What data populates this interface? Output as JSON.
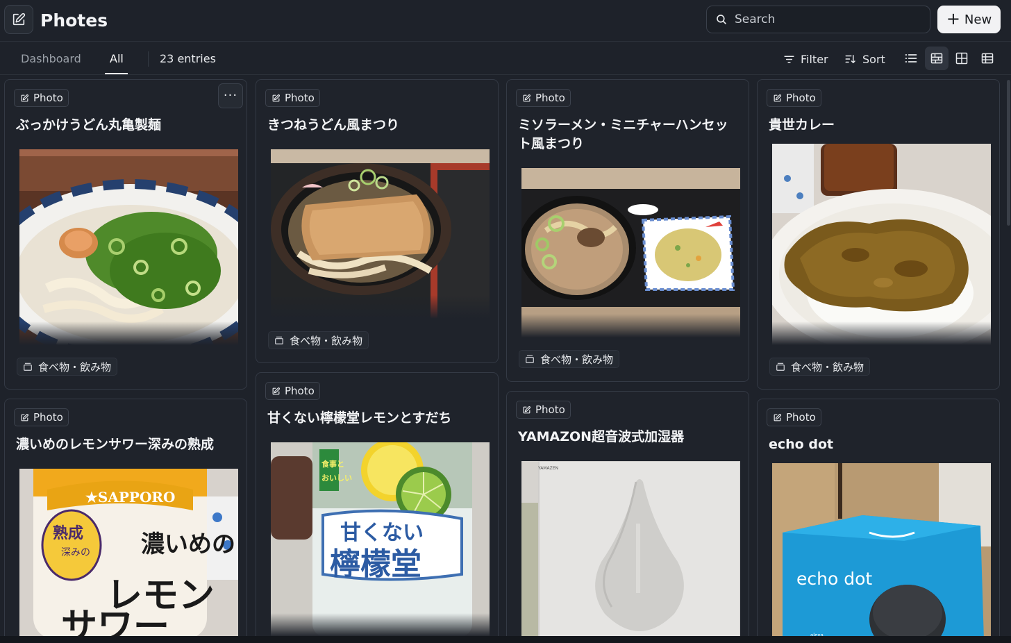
{
  "app": {
    "title": "Photes",
    "icon": "edit-square-icon"
  },
  "search": {
    "placeholder": "Search",
    "icon": "search-icon"
  },
  "new_button": {
    "label": "New",
    "icon": "plus-icon"
  },
  "tabs": [
    {
      "label": "Dashboard",
      "active": false
    },
    {
      "label": "All",
      "active": true
    }
  ],
  "entries_count": "23 entries",
  "toolbar": {
    "filter_label": "Filter",
    "sort_label": "Sort",
    "views": [
      "list-view-icon",
      "masonry-view-icon",
      "grid-view-icon",
      "table-view-icon"
    ],
    "active_view": "masonry-view-icon"
  },
  "cards": [
    {
      "badge": "Photo",
      "title": "ぶっかけうどん丸亀製麺",
      "tag": "食べ物・飲み物",
      "photo": "udon-bowl-with-green-onions"
    },
    {
      "badge": "Photo",
      "title": "きつねうどん風まつり",
      "tag": "食べ物・飲み物",
      "photo": "kitsune-udon-bowl"
    },
    {
      "badge": "Photo",
      "title": "ミソラーメン・ミニチャーハンセット風まつり",
      "tag": "食べ物・飲み物",
      "photo": "miso-ramen-and-fried-rice-tray"
    },
    {
      "badge": "Photo",
      "title": "貴世カレー",
      "tag": "食べ物・飲み物",
      "photo": "curry-rice-plate"
    },
    {
      "badge": "Photo",
      "title": "濃いめのレモンサワー深みの熟成",
      "photo": "sapporo-lemon-sour-can",
      "image_text": [
        "SAPPORO",
        "熟成",
        "深みの",
        "濃いめの",
        "レモン",
        "サワー"
      ]
    },
    {
      "badge": "Photo",
      "title": "甘くない檸檬堂レモンとすだち",
      "photo": "lemondo-can-with-citrus",
      "image_text": [
        "甘くない",
        "檸檬堂",
        "食事と おいしい"
      ]
    },
    {
      "badge": "Photo",
      "title": "YAMAZON超音波式加湿器",
      "photo": "humidifier-box",
      "image_text": [
        "YAMAZEN"
      ]
    },
    {
      "badge": "Photo",
      "title": "echo dot",
      "photo": "echo-dot-box",
      "image_text": [
        "echo dot",
        "alexa"
      ]
    }
  ],
  "more_menu_label": "···"
}
